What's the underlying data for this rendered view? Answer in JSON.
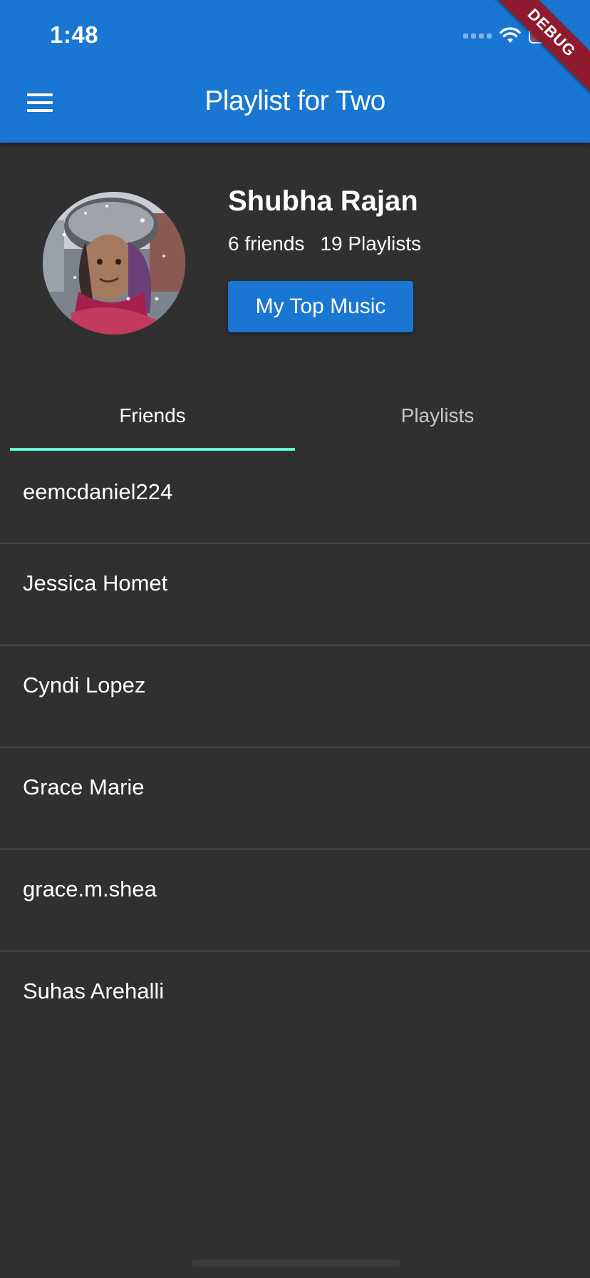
{
  "status_bar": {
    "time": "1:48"
  },
  "app_bar": {
    "title": "Playlist for Two",
    "debug_banner": "DEBUG",
    "accent_color": "#1976d2"
  },
  "profile": {
    "name": "Shubha Rajan",
    "friends_count": "6 friends",
    "playlists_count": "19 Playlists",
    "top_music_button": "My Top Music"
  },
  "tabs": [
    {
      "label": "Friends",
      "active": true
    },
    {
      "label": "Playlists",
      "active": false
    }
  ],
  "tab_indicator_color": "#64ffda",
  "friends": [
    {
      "name": "eemcdaniel224"
    },
    {
      "name": "Jessica Homet"
    },
    {
      "name": "Cyndi Lopez"
    },
    {
      "name": "Grace Marie"
    },
    {
      "name": "grace.m.shea"
    },
    {
      "name": "Suhas Arehalli"
    }
  ],
  "icons": {
    "menu": "menu-icon",
    "wifi": "wifi-icon",
    "battery": "battery-icon",
    "cellular": "cellular-signal-icon"
  },
  "background_color": "#303030"
}
